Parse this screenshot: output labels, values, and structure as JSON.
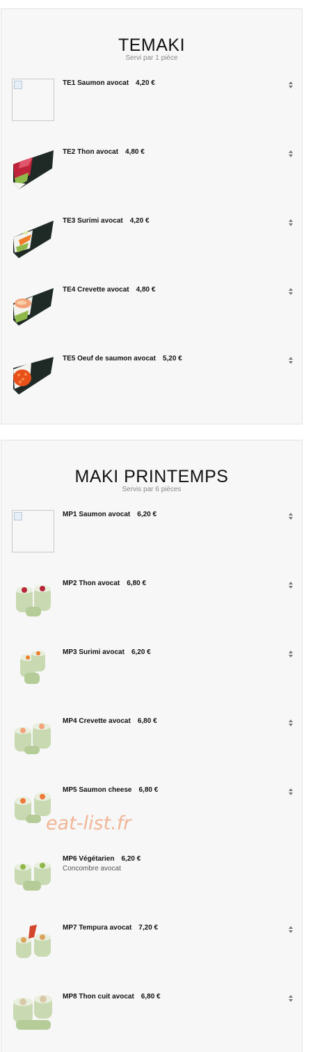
{
  "sections": [
    {
      "title": "TEMAKI",
      "subtitle": "Servi par 1 pièce",
      "items": [
        {
          "code": "TE1",
          "name": "Saumon avocat",
          "price": "4,20 €",
          "image": "broken-image"
        },
        {
          "code": "TE2",
          "name": "Thon avocat",
          "price": "4,80 €",
          "image": "temaki-thon"
        },
        {
          "code": "TE3",
          "name": "Surimi avocat",
          "price": "4,20 €",
          "image": "temaki-surimi"
        },
        {
          "code": "TE4",
          "name": "Crevette avocat",
          "price": "4,80 €",
          "image": "temaki-crevette"
        },
        {
          "code": "TE5",
          "name": "Oeuf de saumon avocat",
          "price": "5,20 €",
          "image": "temaki-oeuf"
        }
      ]
    },
    {
      "title": "MAKI PRINTEMPS",
      "subtitle": "Servis par 6 pièces",
      "items": [
        {
          "code": "MP1",
          "name": "Saumon avocat",
          "price": "6,20 €",
          "image": "broken-image"
        },
        {
          "code": "MP2",
          "name": "Thon avocat",
          "price": "6,80 €",
          "image": "maki-thon"
        },
        {
          "code": "MP3",
          "name": "Surimi avocat",
          "price": "6,20 €",
          "image": "maki-surimi"
        },
        {
          "code": "MP4",
          "name": "Crevette avocat",
          "price": "6,80 €",
          "image": "maki-crevette"
        },
        {
          "code": "MP5",
          "name": "Saumon cheese",
          "price": "6,80 €",
          "image": "maki-saumon-cheese"
        },
        {
          "code": "MP6",
          "name": "Végétarien",
          "price": "6,20 €",
          "description": "Concombre avocat",
          "image": "maki-vegetarien"
        },
        {
          "code": "MP7",
          "name": "Tempura avocat",
          "price": "7,20 €",
          "image": "maki-tempura"
        },
        {
          "code": "MP8",
          "name": "Thon cuit avocat",
          "price": "6,80 €",
          "image": "maki-thon-cuit"
        }
      ]
    }
  ],
  "watermark": "eat-list.fr",
  "stepper_icon": "up-down-arrows-icon",
  "colors": {
    "panel_bg": "#f7f7f7",
    "panel_border": "#e3e3e3",
    "watermark": "#f0b08c",
    "nori": "#1f2a26",
    "rice": "#f4f4ef",
    "rice_paper": "#c9d9b2"
  }
}
